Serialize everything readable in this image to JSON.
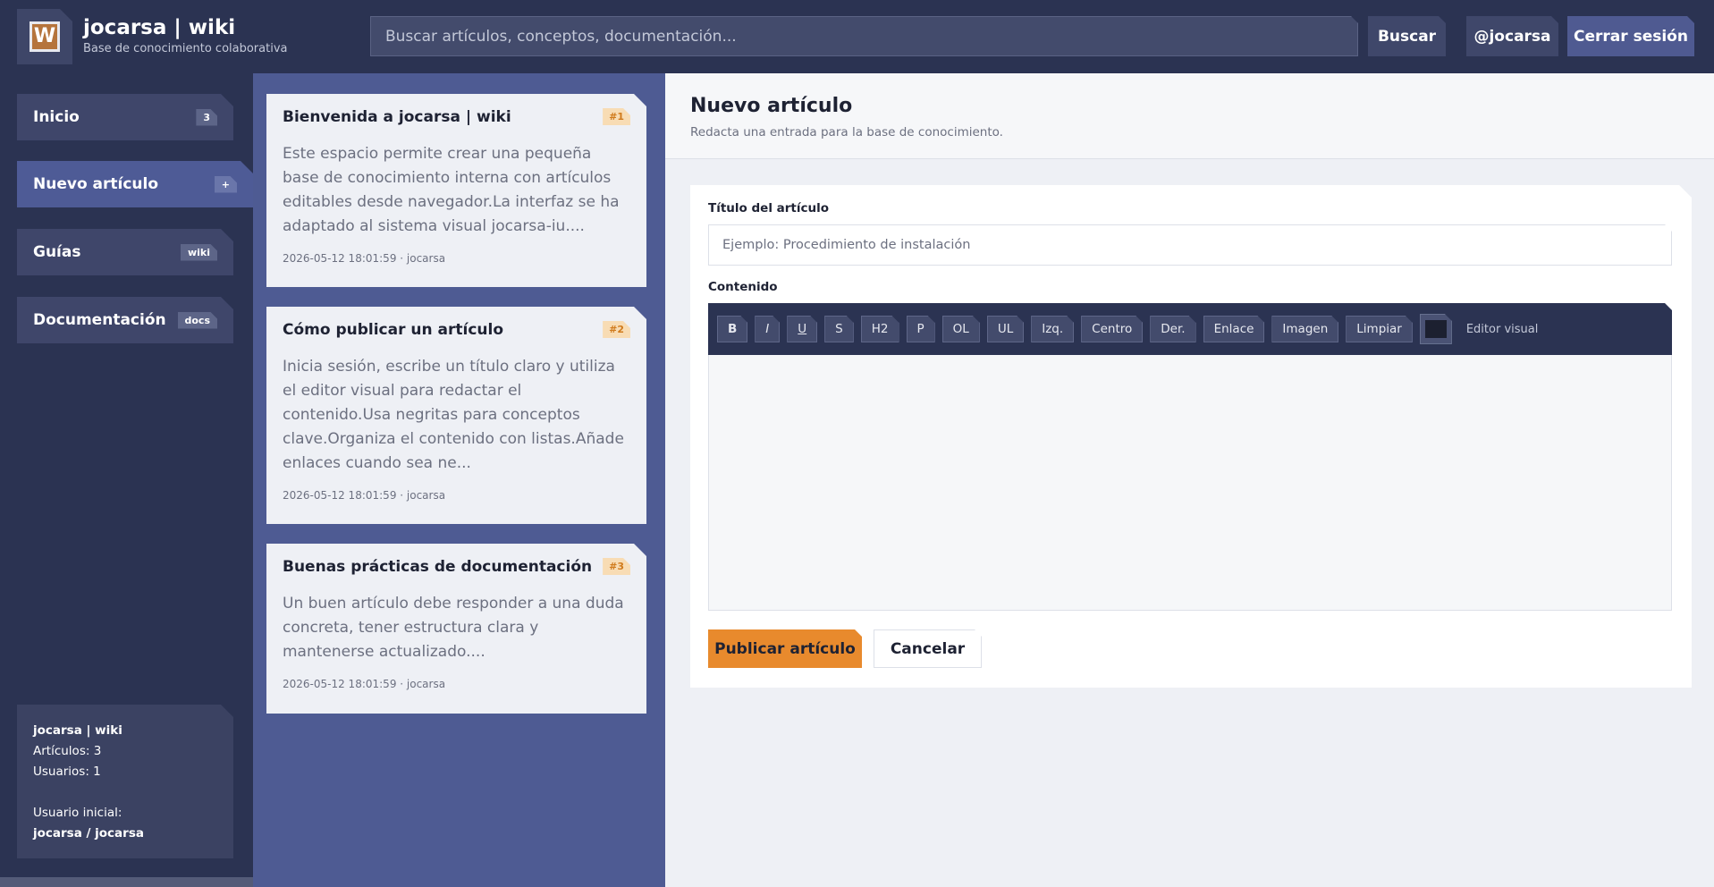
{
  "header": {
    "logo_letter": "W",
    "title": "jocarsa | wiki",
    "subtitle": "Base de conocimiento colaborativa",
    "search_placeholder": "Buscar artículos, conceptos, documentación...",
    "search_button": "Buscar",
    "user_button": "@jocarsa",
    "logout_button": "Cerrar sesión"
  },
  "sidebar": {
    "items": [
      {
        "label": "Inicio",
        "badge": "3"
      },
      {
        "label": "Nuevo artículo",
        "badge": "+"
      },
      {
        "label": "Guías",
        "badge": "wiki"
      },
      {
        "label": "Documentación",
        "badge": "docs"
      }
    ],
    "info": {
      "title": "jocarsa | wiki",
      "articles": "Artículos: 3",
      "users": "Usuarios: 1",
      "initial_user_label": "Usuario inicial:",
      "initial_user_value": "jocarsa / jocarsa"
    }
  },
  "articles": [
    {
      "title": "Bienvenida a jocarsa | wiki",
      "number": "#1",
      "excerpt": "Este espacio permite crear una pequeña base de conocimiento interna con artículos editables desde navegador.La interfaz se ha adaptado al sistema visual jocarsa-iu....",
      "meta": "2026-05-12 18:01:59 · jocarsa"
    },
    {
      "title": "Cómo publicar un artículo",
      "number": "#2",
      "excerpt": "Inicia sesión, escribe un título claro y utiliza el editor visual para redactar el contenido.Usa negritas para conceptos clave.Organiza el contenido con listas.Añade enlaces cuando sea ne...",
      "meta": "2026-05-12 18:01:59 · jocarsa"
    },
    {
      "title": "Buenas prácticas de documentación",
      "number": "#3",
      "excerpt": "Un buen artículo debe responder a una duda concreta, tener estructura clara y mantenerse actualizado....",
      "meta": "2026-05-12 18:01:59 · jocarsa"
    }
  ],
  "main": {
    "title": "Nuevo artículo",
    "subtitle": "Redacta una entrada para la base de conocimiento.",
    "title_label": "Título del artículo",
    "title_placeholder": "Ejemplo: Procedimiento de instalación",
    "content_label": "Contenido",
    "toolbar": [
      "B",
      "I",
      "U",
      "S",
      "H2",
      "P",
      "OL",
      "UL",
      "Izq.",
      "Centro",
      "Der.",
      "Enlace",
      "Imagen",
      "Limpiar"
    ],
    "color_value": "#1c2030",
    "editor_note": "Editor visual",
    "publish_button": "Publicar artículo",
    "cancel_button": "Cancelar"
  }
}
